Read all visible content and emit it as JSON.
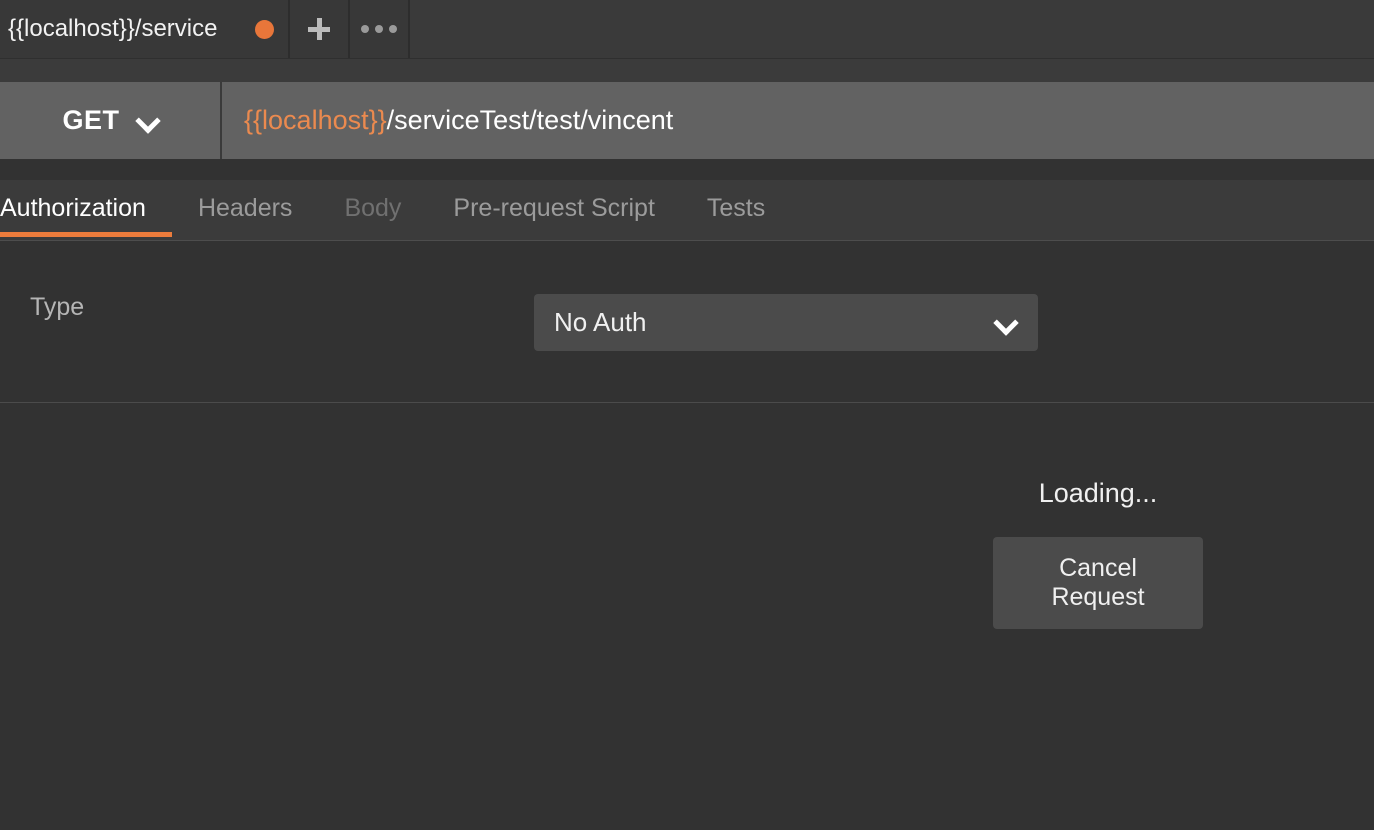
{
  "tabbar": {
    "request_tab": {
      "title": "{{localhost}}/service",
      "unsaved_indicator": "unsaved-dot",
      "unsaved_color": "#e8763a"
    },
    "new_tab_button": {
      "icon": "plus-icon",
      "label": "+"
    },
    "overflow_button": {
      "icon": "ellipsis-icon",
      "label": "•••"
    }
  },
  "urlbar": {
    "method": "GET",
    "method_chevron": "chevron-down-icon",
    "url_variable": "{{localhost}}",
    "url_path": "/serviceTest/test/vincent",
    "url_full": "{{localhost}}/serviceTest/test/vincent",
    "variable_color": "#eb8a4f"
  },
  "request_tabs": {
    "active": "Authorization",
    "accent_color": "#ec7c3c",
    "items": [
      {
        "label": "Authorization",
        "state": "active"
      },
      {
        "label": "Headers",
        "state": "normal"
      },
      {
        "label": "Body",
        "state": "disabled"
      },
      {
        "label": "Pre-request Script",
        "state": "normal"
      },
      {
        "label": "Tests",
        "state": "normal"
      }
    ]
  },
  "auth_panel": {
    "type_label": "Type",
    "type_value": "No Auth",
    "type_chevron": "chevron-down-icon",
    "type_options": [
      "No Auth"
    ]
  },
  "response": {
    "loading_text": "Loading...",
    "cancel_button": "Cancel Request"
  }
}
